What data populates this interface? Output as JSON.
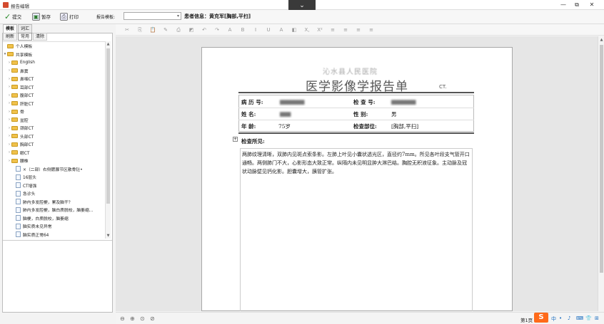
{
  "window": {
    "title": "报告编辑",
    "controls": [
      "—",
      "⧉",
      "✕"
    ]
  },
  "toolbar": {
    "submit": "提交",
    "save_draft": "暂存",
    "print": "打印",
    "template_label": "报告模板:",
    "template_value": "",
    "patient_info": "患者信息：黄克军[胸部,平扫]"
  },
  "left_tabs": [
    "模板",
    "词汇"
  ],
  "left_subtabs": [
    "刷新",
    "常用",
    "清除"
  ],
  "tree": [
    {
      "type": "folder",
      "arrow": "",
      "label": "个人模板"
    },
    {
      "type": "folder",
      "arrow": "▾",
      "label": "共享模板"
    },
    {
      "type": "folder",
      "arrow": "›",
      "label": "English"
    },
    {
      "type": "folder",
      "arrow": "›",
      "label": "鼻窦"
    },
    {
      "type": "folder",
      "arrow": "›",
      "label": "鼻咽CT"
    },
    {
      "type": "folder",
      "arrow": "›",
      "label": "耳部CT"
    },
    {
      "type": "folder",
      "arrow": "›",
      "label": "腹部CT"
    },
    {
      "type": "folder",
      "arrow": "›",
      "label": "肝脏CT"
    },
    {
      "type": "folder",
      "arrow": "›",
      "label": "骨"
    },
    {
      "type": "folder",
      "arrow": "›",
      "label": "盆腔"
    },
    {
      "type": "folder",
      "arrow": "›",
      "label": "颈部CT"
    },
    {
      "type": "folder",
      "arrow": "›",
      "label": "头部CT"
    },
    {
      "type": "folder",
      "arrow": "›",
      "label": "胸部CT"
    },
    {
      "type": "folder",
      "arrow": "›",
      "label": "眼CT"
    },
    {
      "type": "folder",
      "arrow": "›",
      "label": "腰椎"
    },
    {
      "type": "doc",
      "arrow": "",
      "label": "×（二部）右侧腮腺节区散骨钍•"
    },
    {
      "type": "doc",
      "arrow": "",
      "label": "16层头"
    },
    {
      "type": "doc",
      "arrow": "",
      "label": "CT增强"
    },
    {
      "type": "doc",
      "arrow": "",
      "label": "急诊头"
    },
    {
      "type": "doc",
      "arrow": "",
      "label": "肺内多发腔梗，累及脑干？"
    },
    {
      "type": "doc",
      "arrow": "",
      "label": "肺内多发腔梗，脑白质脱校，脑萎缩..."
    },
    {
      "type": "doc",
      "arrow": "",
      "label": "脑梗，白质脱校，脑萎缩"
    },
    {
      "type": "doc",
      "arrow": "",
      "label": "脑实质未见异常"
    },
    {
      "type": "doc",
      "arrow": "",
      "label": "脑实质正常64"
    }
  ],
  "format_bar": [
    "✂",
    "⎘",
    "📋",
    "✎",
    "⎙",
    "◩",
    "↶",
    "↷",
    "A",
    "B",
    "I",
    "U",
    "A",
    "◧",
    "X,",
    "X²",
    "≡",
    "≡",
    "≡",
    "≡"
  ],
  "report": {
    "hospital": "沁水县人民医院",
    "title": "医学影像学报告单",
    "ct_label": "CT.",
    "fields": {
      "record_no_label": "病 历 号:",
      "record_no_value": "▆▆▆▆▆▆▆",
      "exam_no_label": "检 查 号:",
      "exam_no_value": "▆▆▆▆▆▆▆",
      "name_label": "姓    名:",
      "name_value": "▆▆▆",
      "gender_label": "性    别:",
      "gender_value": "男",
      "age_label": "年    龄:",
      "age_value": "75岁",
      "site_label": "检查部位:",
      "site_value": "[胸部,平扫]"
    },
    "findings_label": "检查所见:",
    "findings_text": "两肺纹理清晰，双肺内见斑点索条影。左肺上叶见小囊状透光区，直径约7mm。所见各叶段支气管开口通畅。两侧肺门不大，心影形态大致正常。纵隔内未见明显肿大淋巴结。胸腔无积液征象。主动脉及冠状动脉壁见钙化影。胆囊增大，胰管扩张。"
  },
  "status": {
    "page": "第1页",
    "zoom_icons": [
      "zoom-out-icon",
      "zoom-in-icon",
      "zoom-fit-icon",
      "zoom-reset-icon"
    ],
    "ime": "S"
  }
}
